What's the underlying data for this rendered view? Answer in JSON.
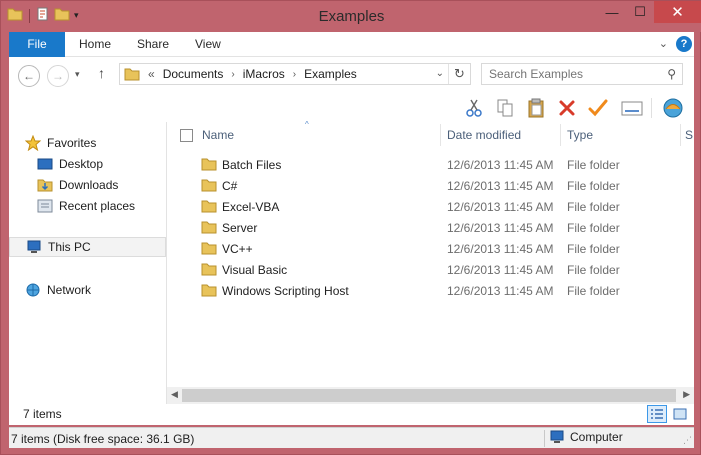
{
  "window": {
    "title": "Examples"
  },
  "ribbon": {
    "tabs": [
      "File",
      "Home",
      "Share",
      "View"
    ],
    "help": "?"
  },
  "address": {
    "breadcrumb": [
      "Documents",
      "iMacros",
      "Examples"
    ],
    "overflow": "«"
  },
  "search": {
    "placeholder": "Search Examples"
  },
  "toolbar": {
    "icons": [
      "cut-icon",
      "copy-icon",
      "paste-icon",
      "delete-icon",
      "rename-icon",
      "properties-icon",
      "imacros-icon"
    ]
  },
  "navpane": {
    "favorites": "Favorites",
    "favorites_items": [
      "Desktop",
      "Downloads",
      "Recent places"
    ],
    "this_pc": "This PC",
    "network": "Network"
  },
  "columns": {
    "name": "Name",
    "date": "Date modified",
    "type": "Type",
    "size": "S"
  },
  "files": [
    {
      "name": "Batch Files",
      "date": "12/6/2013 11:45 AM",
      "type": "File folder"
    },
    {
      "name": "C#",
      "date": "12/6/2013 11:45 AM",
      "type": "File folder"
    },
    {
      "name": "Excel-VBA",
      "date": "12/6/2013 11:45 AM",
      "type": "File folder"
    },
    {
      "name": "Server",
      "date": "12/6/2013 11:45 AM",
      "type": "File folder"
    },
    {
      "name": "VC++",
      "date": "12/6/2013 11:45 AM",
      "type": "File folder"
    },
    {
      "name": "Visual Basic",
      "date": "12/6/2013 11:45 AM",
      "type": "File folder"
    },
    {
      "name": "Windows Scripting Host",
      "date": "12/6/2013 11:45 AM",
      "type": "File folder"
    }
  ],
  "status": {
    "count": "7 items",
    "details": "7 items (Disk free space: 36.1 GB)",
    "location": "Computer"
  },
  "colors": {
    "titlebar": "#c0646e",
    "accent": "#1979ca",
    "folder": "#e8c35a"
  }
}
